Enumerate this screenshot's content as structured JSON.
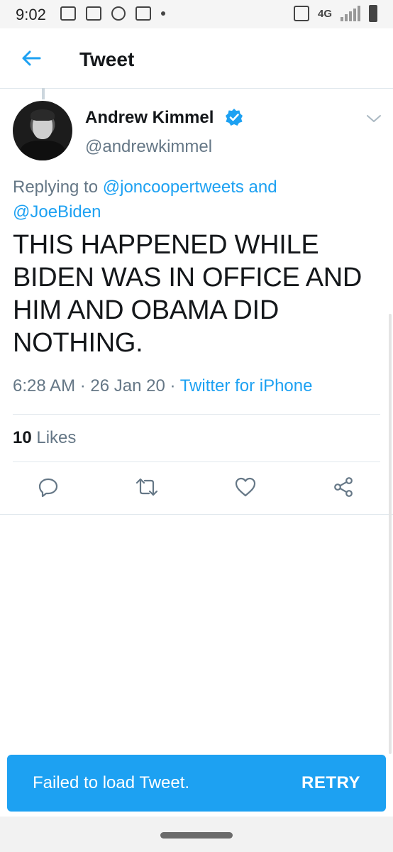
{
  "status_bar": {
    "time": "9:02",
    "network": "4G",
    "left_icons": [
      "news-icon",
      "ok-icon",
      "settings-icon",
      "gmail-icon",
      "dot-icon"
    ],
    "right_icons": [
      "vibrate-icon",
      "lte-icon",
      "signal-icon",
      "battery-icon"
    ]
  },
  "app_bar": {
    "title": "Tweet",
    "back_icon": "back-arrow-icon"
  },
  "tweet": {
    "author_name": "Andrew Kimmel",
    "verified": true,
    "handle": "@andrewkimmel",
    "reply_prefix": "Replying to ",
    "reply_user1": "@joncoopertweets",
    "reply_and": " and",
    "reply_user2": "@JoeBiden",
    "text": "THIS HAPPENED WHILE BIDEN WAS IN OFFICE AND HIM AND OBAMA DID NOTHING.",
    "time": "6:28 AM",
    "date": "26 Jan 20",
    "separator": " · ",
    "source": "Twitter for iPhone",
    "likes_count": "10",
    "likes_label": "Likes"
  },
  "actions": [
    "reply-icon",
    "retweet-icon",
    "like-icon",
    "share-icon"
  ],
  "snackbar": {
    "message": "Failed to load Tweet.",
    "action": "RETRY"
  },
  "colors": {
    "accent": "#1da1f2",
    "secondary_text": "#657786",
    "primary_text": "#14171a",
    "divider": "#e1e8ed"
  }
}
